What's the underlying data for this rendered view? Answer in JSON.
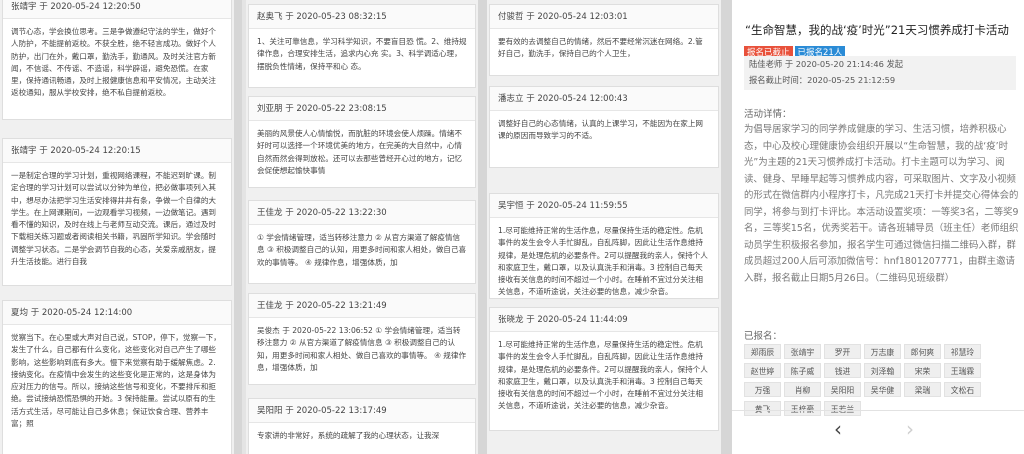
{
  "posts": [
    {
      "author_line": "张靖宇 于 2020-05-24 12:20:50",
      "text": "调节心态，学会换位思考。三是争做遵纪守法的学生，做好个人防护，不能提前返校。不获全胜，绝不轻言成功。做好个人防护，出门在外，戴口罩，勤洗手，勤通风。及时关注官方新闻，不信谣、不传谣、不造谣，科学辟谣，避免恐慌。在家里，保持通讯畅通，及时上报健康信息和平安情况，主动关注返校通知，服从学校安排，绝不私自提前返校。"
    },
    {
      "author_line": "张靖宇 于 2020-05-24 12:20:15",
      "text": "一是制定合理的学习计划，重视网络课程，不能迟到旷课。制定合理的学习计划可以尝试以分钟为单位，把必做事项列入其中，想尽办法把学习生活安排得井井有条，争做一个自律的大学生。在上网课期间，一边观看学习视频，一边做笔记。遇到看不懂的知识，及时在线上与老师互动交流。课后，通过及时下载相关练习题或者阅读相关书籍，巩固所学知识。学会随时调整学习状态。二是学会调节自我的心态，关爱亲戚朋友，提升生活技能。进行自我"
    },
    {
      "author_line": "夏均 于 2020-05-24 12:14:00",
      "text": "觉察当下。在心里或大声对自己说，STOP，停下，觉察一下，发生了什么，自己都有什么变化，这些变化对自己产生了哪些影响，这些影响到底有多大。慢下来觉察有助于缓解焦虑。2.接纳变化。在疫情中会发生的这些变化是正常的，这是身体为应对压力的信号。所以，接纳这些信号和变化，不要排斥和拒绝。尝试接纳恐慌恐惧的开始。3 保持能量。尝试以原有的生活方式生活，尽可能让自己多休息；保证饮食合理、营养丰富；照"
    },
    {
      "author_line": "赵奥飞 于 2020-05-23 08:32:15",
      "text": "1、关注可靠信息，学习科学知识，不要盲目恐 慌。2、维持规律作息，合理安排生活，追求内心充 实。3、科学调适心理，摆脱负性情绪，保持平和心 态。"
    },
    {
      "author_line": "刘亚朋 于 2020-05-22 23:08:15",
      "text": "美丽的风景使人心情愉悦，而肮脏的环境会使人烦躁。情绪不好时可以选择一个环境优美的地方，在完美的大自然中，心情自然而然会得到放松。还可以去那些曾经开心过的地方，记忆会促使想起愉快事情"
    },
    {
      "author_line": "王佳龙 于 2020-05-22 13:22:30",
      "text": "① 学会情绪管理，适当转移注意力 ② 从官方渠道了解疫情信息 ③ 积极调整自己的认知，用更多时间和家人相处，做自己喜欢的事情等。 ④ 规律作息，增强体质，加"
    },
    {
      "author_line": "王佳龙 于 2020-05-22 13:21:49",
      "text": "吴俊杰 于 2020-05-22 13:06:52 ① 学会情绪管理，适当转移注意力 ② 从官方渠道了解疫情信息 ③ 积极调整自己的认知，用更多时间和家人相处、做自己喜欢的事情等。 ④ 规律作息，增强体质，加"
    },
    {
      "author_line": "吴阳阳 于 2020-05-22 13:17:49",
      "text": "专家讲的非常好，系统的疏解了我的心理状态，让我深"
    },
    {
      "author_line": "付骏哲 于 2020-05-24 12:03:01",
      "text": "要有效的去调整自己的情绪，然后不要经常沉迷在网络。2.管好自己，勤洗手，保持自己的个人卫生，"
    },
    {
      "author_line": "潘志立 于 2020-05-24 12:00:43",
      "text": "调整好自己的心态情绪，认真的上课学习，不能因为在家上网课的原因而导致学习的不适。"
    },
    {
      "author_line": "吴宇恒 于 2020-05-24 11:59:55",
      "text": "1.尽可能维持正常的生活作息，尽量保持生活的稳定性。危机事件的发生会令人手忙脚乱，自乱阵脚，因此让生活作息维持规律，是处理危机的必要条件。2可以提醒我的亲人，保持个人和家庭卫生，戴口罩，以及认真洗手和消毒。3 控制自己每天接收有关信息的时间不超过一个小时。在睡前不宜过分关注相关信息，不道听途说，关注必要的信息，减少杂音。"
    },
    {
      "author_line": "张晓龙 于 2020-05-24 11:44:09",
      "text": "1.尽可能维持正常的生活作息，尽量保持生活的稳定性。危机事件的发生会令人手忙脚乱，自乱阵脚，因此让生活作息维持规律，是处理危机的必要条件。2可以提醒我的亲人，保持个人和家庭卫生，戴口罩，以及认真洗手和消毒。3 控制自己每天接收有关信息的时间不超过一个小时，在睡前不宜过分关注相关信息，不道听途说，关注必要的信息，减少杂音。"
    }
  ],
  "detail": {
    "title": "“生命智慧，我的战‘疫’时光”21天习惯养成打卡活动",
    "badge_closed": "报名已截止",
    "badge_count": "已报名21人",
    "publisher_line": "陆佳老师 于 2020-05-20 21:14:46 发起",
    "deadline_line": "报名截止时间：2020-05-25 21:12:59",
    "detail_label": "活动详情：",
    "detail_text": "为倡导居家学习的同学养成健康的学习、生活习惯，培养积极心态，中心及校心理健康协会组织开展以“生命智慧，我的战‘疫’时光”为主题的21天习惯养成打卡活动。打卡主题可以为学习、阅读、健身、早睡早起等习惯养成内容，可采取图片、文字及小视频的形式在微信群内小程序打卡，凡完成21天打卡并提交心得体会的同学，将参与到打卡评比。本活动设置奖项：一等奖3名，二等奖9名，三等奖15名，优秀奖若干。请各班辅导员（班主任）老师组织动员学生积极报名参加，报名学生可通过微信扫描二维码入群，群成员超过200人后可添加微信号：hnf1801207771，由群主邀请入群，报名截止日期5月26日。（二维码见班级群）",
    "signed_label": "已报名：",
    "names": [
      "郑雨辰",
      "张靖宇",
      "罗开",
      "万志康",
      "郎何爽",
      "祁慧玲",
      "赵世婷",
      "陈子威",
      "钱进",
      "刘泽翰",
      "宋荣",
      "王瑞霖",
      "万强",
      "肖柳",
      "吴阳阳",
      "吴华健",
      "梁瑞",
      "文松石",
      "黄飞",
      "王梓豪",
      "王若兰"
    ]
  },
  "nav": {
    "prev": "‹",
    "next": "›"
  },
  "colors": {
    "accent_red": "#e8513b",
    "accent_blue": "#2a8bd6"
  }
}
